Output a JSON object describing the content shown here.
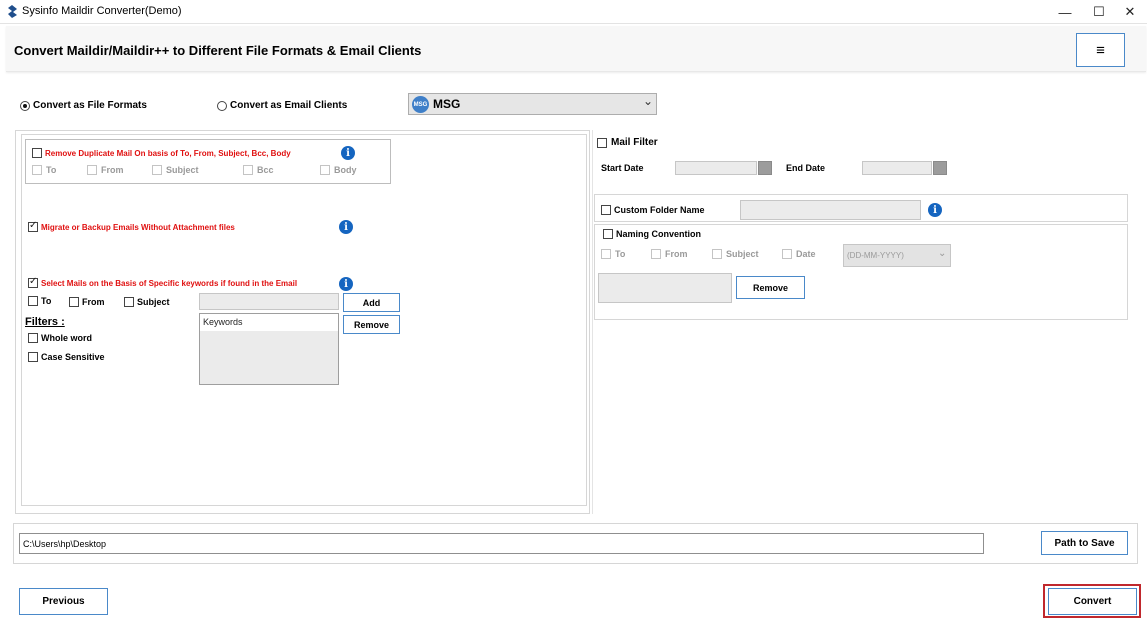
{
  "window": {
    "title": "Sysinfo Maildir Converter(Demo)",
    "minimize": "—",
    "maximize": "☐",
    "close": "✕"
  },
  "header": {
    "title": "Convert Maildir/Maildir++ to Different File Formats & Email Clients",
    "menu_icon": "≡"
  },
  "mode": {
    "file_formats_label": "Convert as File Formats",
    "file_formats_selected": true,
    "email_clients_label": "Convert as Email Clients",
    "email_clients_selected": false
  },
  "format_select": {
    "icon_text": "MSG",
    "value": "MSG",
    "arrow": "⌄"
  },
  "left": {
    "duplicate": {
      "label": "Remove Duplicate Mail On basis of To, From, Subject, Bcc, Body",
      "checked": false,
      "fields": [
        "To",
        "From",
        "Subject",
        "Bcc",
        "Body"
      ]
    },
    "attachment": {
      "label": "Migrate or Backup Emails Without Attachment files",
      "checked": true
    },
    "keywords": {
      "label": "Select Mails on the Basis of Specific keywords if found in the Email",
      "checked": true,
      "to": "To",
      "from": "From",
      "subject": "Subject",
      "add_button": "Add",
      "remove_button": "Remove",
      "list_header": "Keywords",
      "filters_label": "Filters :",
      "whole_word": "Whole word",
      "case_sensitive": "Case Sensitive"
    },
    "info_icon": "i"
  },
  "right": {
    "mail_filter": {
      "label": "Mail Filter",
      "start_date_label": "Start Date",
      "end_date_label": "End Date"
    },
    "custom_folder": {
      "label": "Custom Folder Name"
    },
    "naming": {
      "label": "Naming Convention",
      "fields": [
        "To",
        "From",
        "Subject",
        "Date"
      ],
      "date_format": "(DD-MM-YYYY)",
      "remove_button": "Remove"
    }
  },
  "path": {
    "value": "C:\\Users\\hp\\Desktop",
    "save_button": "Path to Save"
  },
  "footer": {
    "previous_button": "Previous",
    "convert_button": "Convert"
  },
  "colors": {
    "accent": "#4a89c9",
    "required_red": "#e01010",
    "info_blue": "#1565c0",
    "convert_highlight": "#c0282d"
  }
}
